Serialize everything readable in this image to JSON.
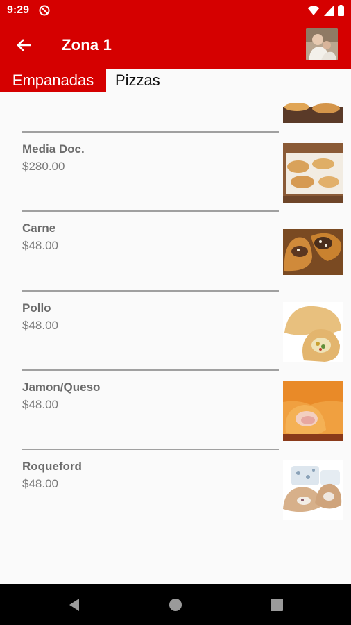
{
  "status_bar": {
    "time": "9:29"
  },
  "app_bar": {
    "title": "Zona 1"
  },
  "tabs": [
    {
      "label": "Empanadas",
      "active": true
    },
    {
      "label": "Pizzas",
      "active": false
    }
  ],
  "products": [
    {
      "name": "Media Doc.",
      "price": "$280.00",
      "image": "empanadas-tray"
    },
    {
      "name": "Carne",
      "price": "$48.00",
      "image": "empanada-carne"
    },
    {
      "name": "Pollo",
      "price": "$48.00",
      "image": "empanada-pollo"
    },
    {
      "name": "Jamon/Queso",
      "price": "$48.00",
      "image": "empanada-jamon-queso"
    },
    {
      "name": "Roqueford",
      "price": "$48.00",
      "image": "empanada-roqueford"
    }
  ],
  "colors": {
    "primary": "#d50000",
    "background": "#fafafa",
    "divider": "#a0a0a0"
  }
}
